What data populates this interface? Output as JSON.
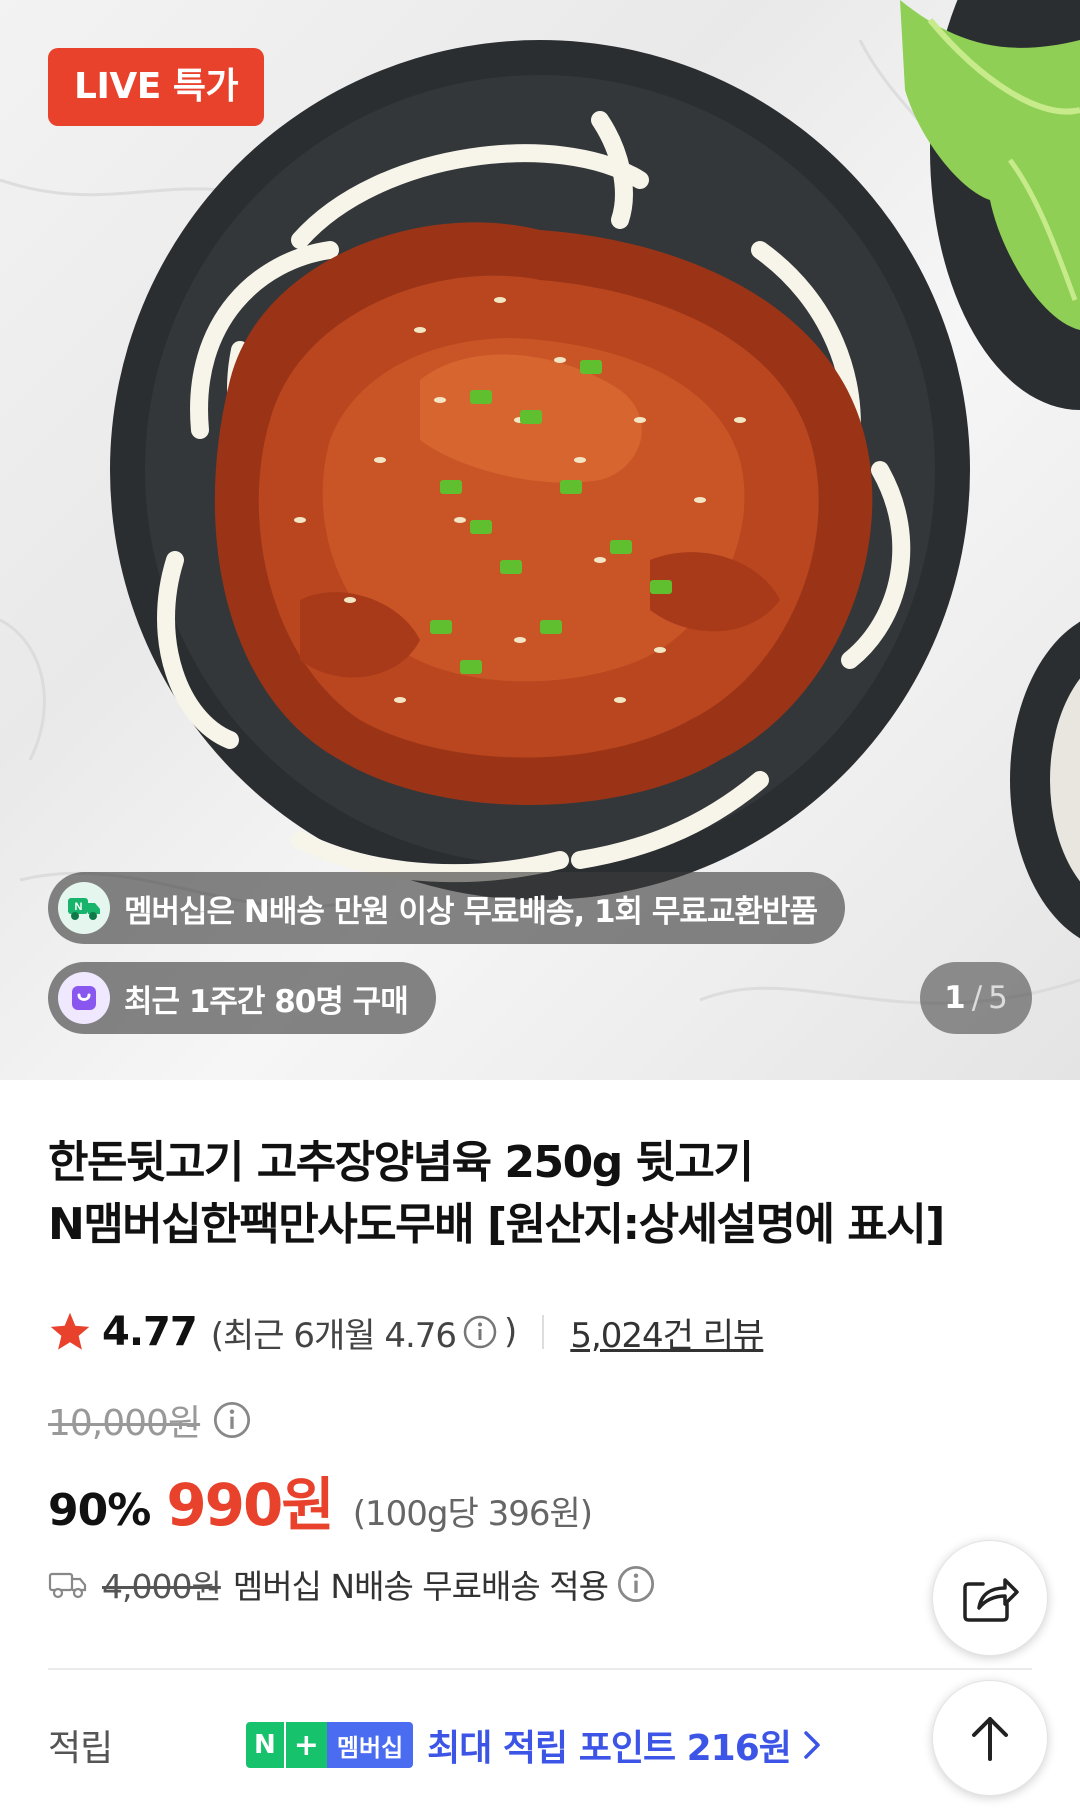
{
  "hero": {
    "live_badge": "LIVE 특가",
    "membership_pill": "멤버십은 N배송 만원 이상 무료배송, 1회 무료교환반품",
    "recent_pill": "최근 1주간 80명 구매",
    "counter_current": "1",
    "counter_separator": "/",
    "counter_total": "5"
  },
  "product": {
    "title_line1": "한돈뒷고기 고추장양념육 250g 뒷고기",
    "title_line2": "N맴버십한팩만사도무배 [원산지:상세설명에 표시]",
    "rating": "4.77",
    "rating_recent_prefix": "(최근 6개월 4.76",
    "rating_recent_suffix": ")",
    "review_count": "5,024건 리뷰",
    "original_price": "10,000원",
    "discount_rate": "90%",
    "sale_price": "990원",
    "unit_price": "(100g당 396원)"
  },
  "shipping": {
    "fee": "4,000원",
    "description": "멤버십 N배송 무료배송 적용"
  },
  "points": {
    "label": "적립",
    "badge_n": "N",
    "badge_plus": "+",
    "badge_membership": "멤버십",
    "text": "최대 적립 포인트 216원"
  },
  "icons": {
    "star": "star-icon",
    "info": "info-icon",
    "truck": "truck-icon",
    "share": "share-icon",
    "top": "arrow-up-icon",
    "chevron": "chevron-right-icon",
    "bag": "shopping-bag-icon"
  },
  "colors": {
    "accent_red": "#e8412c",
    "points_blue": "#3d55e6",
    "naver_green": "#16c26b",
    "membership_blue": "#4a6cf0"
  }
}
